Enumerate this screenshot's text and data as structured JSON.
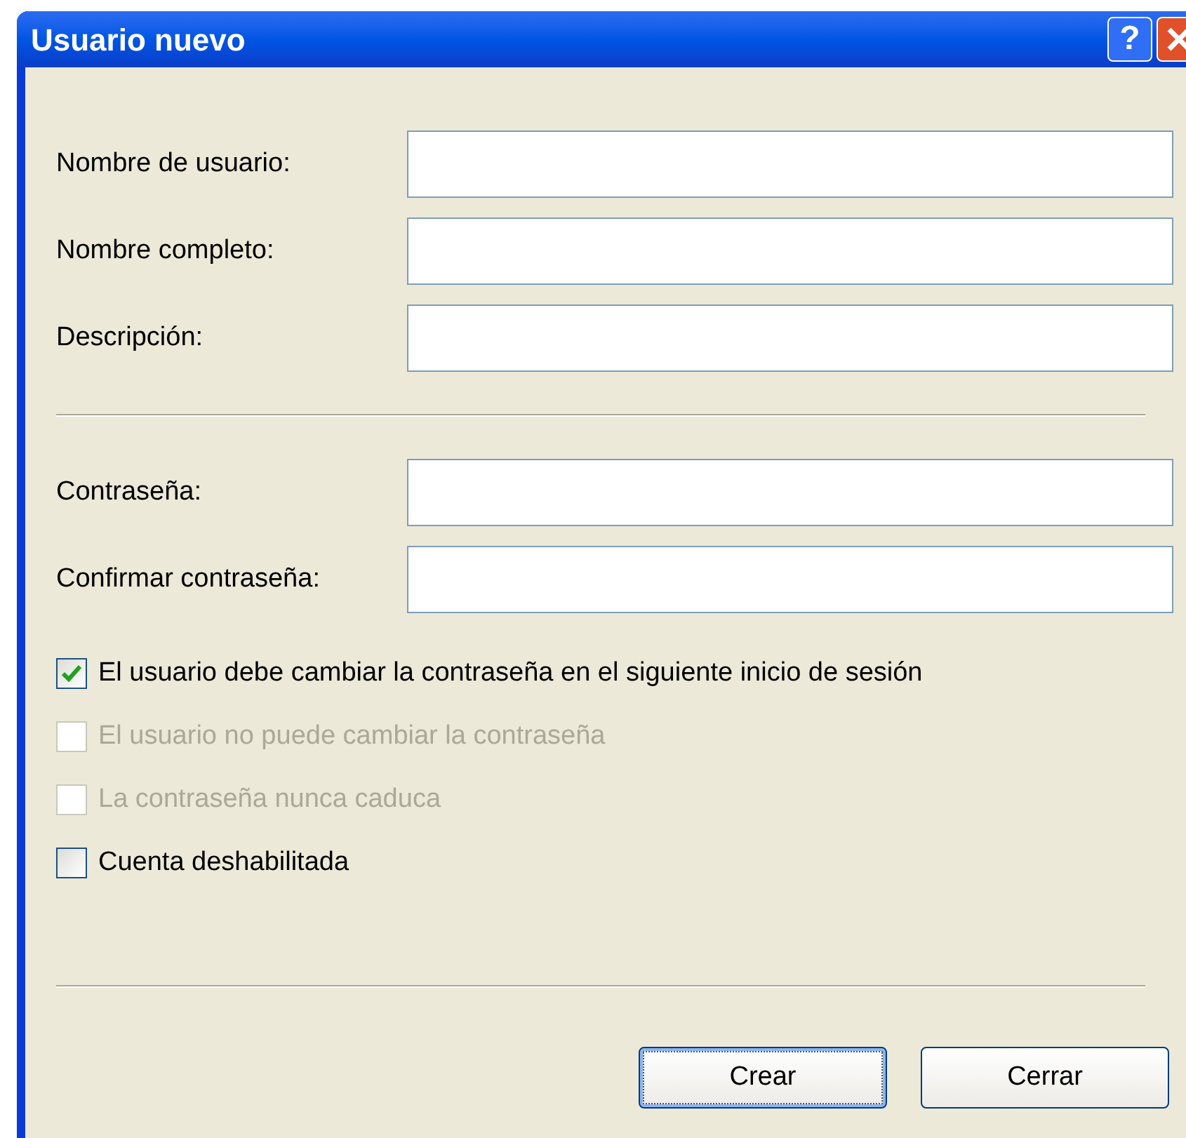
{
  "window": {
    "title": "Usuario nuevo"
  },
  "title_buttons": [
    {
      "kind": "help",
      "label": "?"
    },
    {
      "kind": "close"
    }
  ],
  "fields": [
    {
      "label": "Nombre de usuario:"
    },
    {
      "label": "Nombre completo:"
    },
    {
      "label": "Descripción:"
    }
  ],
  "password_fields": [
    {
      "label": "Contraseña:"
    },
    {
      "label": "Confirmar contraseña:"
    }
  ],
  "options": [
    {
      "label": "El usuario debe cambiar la contraseña en el siguiente inicio de sesión",
      "checked": true,
      "disabled": false
    },
    {
      "label": "El usuario no puede cambiar la contraseña",
      "checked": false,
      "disabled": true
    },
    {
      "label": "La contraseña nunca caduca",
      "checked": false,
      "disabled": true
    },
    {
      "label": "Cuenta deshabilitada",
      "checked": false,
      "disabled": false
    }
  ],
  "buttons": [
    {
      "label": "Crear",
      "selected": true
    },
    {
      "label": "Cerrar",
      "selected": false
    }
  ]
}
